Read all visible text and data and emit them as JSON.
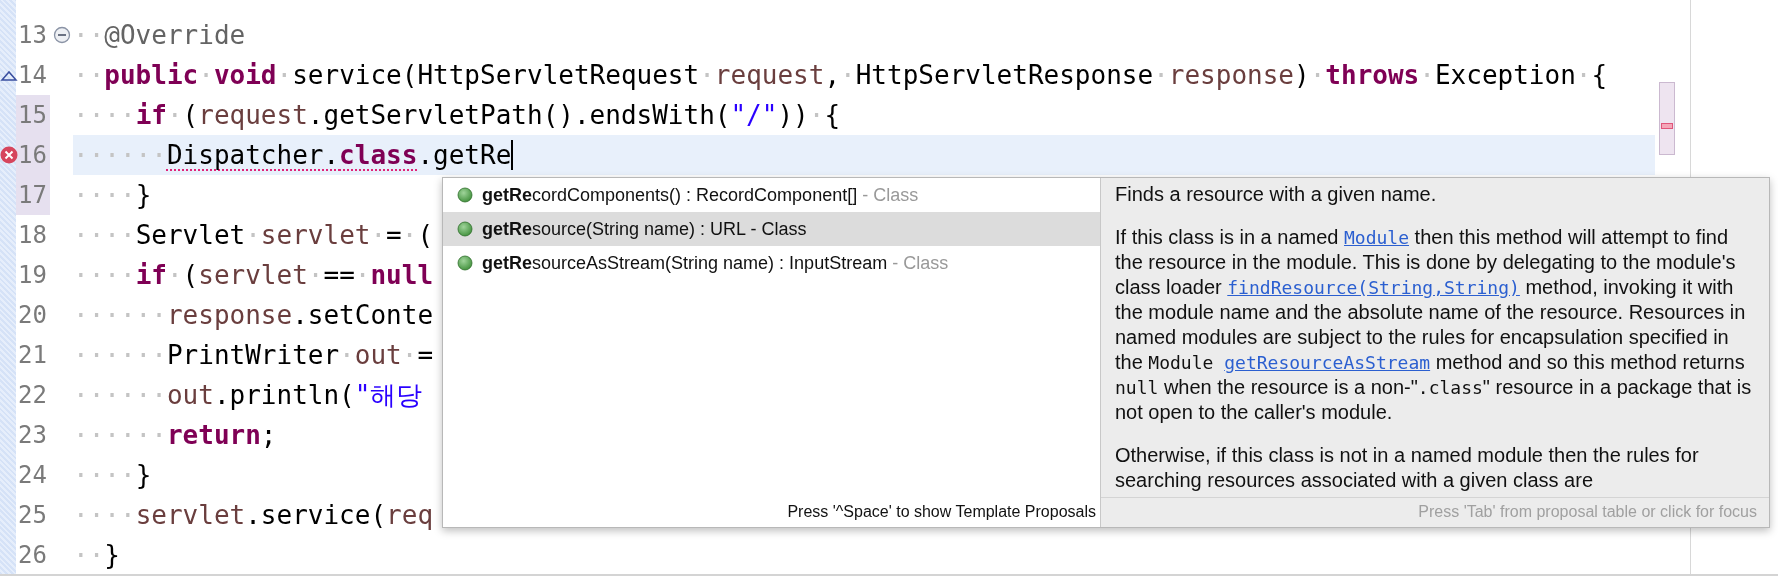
{
  "editor": {
    "lines": [
      {
        "number": "13",
        "kind": "fold",
        "changed": false,
        "current": false,
        "caret": false,
        "tokens": [
          {
            "kind": "ws",
            "text": "··"
          },
          {
            "kind": "ann",
            "text": "@Override"
          }
        ]
      },
      {
        "number": "14",
        "kind": "override",
        "changed": false,
        "current": false,
        "caret": false,
        "tokens": [
          {
            "kind": "ws",
            "text": "··"
          },
          {
            "kind": "kw",
            "text": "public"
          },
          {
            "kind": "ws",
            "text": "·"
          },
          {
            "kind": "kw",
            "text": "void"
          },
          {
            "kind": "ws",
            "text": "·"
          },
          {
            "kind": "txt",
            "text": "service(HttpServletRequest"
          },
          {
            "kind": "ws",
            "text": "·"
          },
          {
            "kind": "var",
            "text": "request"
          },
          {
            "kind": "txt",
            "text": ","
          },
          {
            "kind": "ws",
            "text": "·"
          },
          {
            "kind": "txt",
            "text": "HttpServletResponse"
          },
          {
            "kind": "ws",
            "text": "·"
          },
          {
            "kind": "var",
            "text": "response"
          },
          {
            "kind": "txt",
            "text": ")"
          },
          {
            "kind": "ws",
            "text": "·"
          },
          {
            "kind": "kw",
            "text": "throws"
          },
          {
            "kind": "ws",
            "text": "·"
          },
          {
            "kind": "txt",
            "text": "Exception"
          },
          {
            "kind": "ws",
            "text": "·"
          },
          {
            "kind": "txt",
            "text": "{"
          }
        ]
      },
      {
        "number": "15",
        "kind": "plain",
        "changed": true,
        "current": false,
        "caret": false,
        "tokens": [
          {
            "kind": "ws",
            "text": "····"
          },
          {
            "kind": "kw",
            "text": "if"
          },
          {
            "kind": "ws",
            "text": "·"
          },
          {
            "kind": "txt",
            "text": "("
          },
          {
            "kind": "var",
            "text": "request"
          },
          {
            "kind": "txt",
            "text": ".getServletPath().endsWith("
          },
          {
            "kind": "str",
            "text": "\"/\""
          },
          {
            "kind": "txt",
            "text": "))"
          },
          {
            "kind": "ws",
            "text": "·"
          },
          {
            "kind": "txt",
            "text": "{"
          }
        ]
      },
      {
        "number": "16",
        "kind": "error",
        "changed": true,
        "current": true,
        "caret": true,
        "tokens": [
          {
            "kind": "ws",
            "text": "······"
          },
          {
            "kind": "errtxt",
            "text": "Dispatcher."
          },
          {
            "kind": "errkw",
            "text": "class"
          },
          {
            "kind": "txt",
            "text": ".getRe"
          }
        ]
      },
      {
        "number": "17",
        "kind": "plain",
        "changed": true,
        "current": false,
        "caret": false,
        "tokens": [
          {
            "kind": "ws",
            "text": "····"
          },
          {
            "kind": "txt",
            "text": "}"
          }
        ]
      },
      {
        "number": "18",
        "kind": "plain",
        "changed": false,
        "current": false,
        "caret": false,
        "tokens": [
          {
            "kind": "ws",
            "text": "····"
          },
          {
            "kind": "txt",
            "text": "Servlet"
          },
          {
            "kind": "ws",
            "text": "·"
          },
          {
            "kind": "var",
            "text": "servlet"
          },
          {
            "kind": "ws",
            "text": "·"
          },
          {
            "kind": "txt",
            "text": "="
          },
          {
            "kind": "ws",
            "text": "·"
          },
          {
            "kind": "txt",
            "text": "("
          }
        ]
      },
      {
        "number": "19",
        "kind": "plain",
        "changed": false,
        "current": false,
        "caret": false,
        "tokens": [
          {
            "kind": "ws",
            "text": "····"
          },
          {
            "kind": "kw",
            "text": "if"
          },
          {
            "kind": "ws",
            "text": "·"
          },
          {
            "kind": "txt",
            "text": "("
          },
          {
            "kind": "var",
            "text": "servlet"
          },
          {
            "kind": "ws",
            "text": "·"
          },
          {
            "kind": "txt",
            "text": "=="
          },
          {
            "kind": "ws",
            "text": "·"
          },
          {
            "kind": "kw",
            "text": "null"
          }
        ]
      },
      {
        "number": "20",
        "kind": "plain",
        "changed": false,
        "current": false,
        "caret": false,
        "tokens": [
          {
            "kind": "ws",
            "text": "······"
          },
          {
            "kind": "var",
            "text": "response"
          },
          {
            "kind": "txt",
            "text": ".setConte"
          }
        ]
      },
      {
        "number": "21",
        "kind": "plain",
        "changed": false,
        "current": false,
        "caret": false,
        "tokens": [
          {
            "kind": "ws",
            "text": "······"
          },
          {
            "kind": "txt",
            "text": "PrintWriter"
          },
          {
            "kind": "ws",
            "text": "·"
          },
          {
            "kind": "var",
            "text": "out"
          },
          {
            "kind": "ws",
            "text": "·"
          },
          {
            "kind": "txt",
            "text": "="
          }
        ]
      },
      {
        "number": "22",
        "kind": "plain",
        "changed": false,
        "current": false,
        "caret": false,
        "tokens": [
          {
            "kind": "ws",
            "text": "······"
          },
          {
            "kind": "var",
            "text": "out"
          },
          {
            "kind": "txt",
            "text": ".println("
          },
          {
            "kind": "str",
            "text": "\"해당"
          }
        ]
      },
      {
        "number": "23",
        "kind": "plain",
        "changed": false,
        "current": false,
        "caret": false,
        "tokens": [
          {
            "kind": "ws",
            "text": "······"
          },
          {
            "kind": "kw",
            "text": "return"
          },
          {
            "kind": "txt",
            "text": ";"
          }
        ]
      },
      {
        "number": "24",
        "kind": "plain",
        "changed": false,
        "current": false,
        "caret": false,
        "tokens": [
          {
            "kind": "ws",
            "text": "····"
          },
          {
            "kind": "txt",
            "text": "}"
          }
        ]
      },
      {
        "number": "25",
        "kind": "plain",
        "changed": false,
        "current": false,
        "caret": false,
        "tokens": [
          {
            "kind": "ws",
            "text": "····"
          },
          {
            "kind": "var",
            "text": "servlet"
          },
          {
            "kind": "txt",
            "text": ".service("
          },
          {
            "kind": "var",
            "text": "req"
          }
        ]
      },
      {
        "number": "26",
        "kind": "plain",
        "changed": false,
        "current": false,
        "caret": false,
        "tokens": [
          {
            "kind": "ws",
            "text": "··"
          },
          {
            "kind": "txt",
            "text": "}"
          }
        ]
      }
    ]
  },
  "completion": {
    "proposals": [
      {
        "match": "getRe",
        "rest": "cordComponents() : RecordComponent[]",
        "qualifier": "- Class",
        "selected": false
      },
      {
        "match": "getRe",
        "rest": "source(String name) : URL",
        "qualifier": "- Class",
        "selected": true
      },
      {
        "match": "getRe",
        "rest": "sourceAsStream(String name) : InputStream",
        "qualifier": "- Class",
        "selected": false
      }
    ],
    "footer": "Press '^Space' to show Template Proposals",
    "doc": {
      "paragraphs": [
        [
          {
            "kind": "text",
            "text": "Finds a resource with a given name."
          }
        ],
        [
          {
            "kind": "text",
            "text": "If this class is in a named "
          },
          {
            "kind": "link",
            "text": "Module"
          },
          {
            "kind": "text",
            "text": " then this method will attempt to find the resource in the module. This is done by delegating to the module's class loader "
          },
          {
            "kind": "link",
            "text": "findResource(String,String)"
          },
          {
            "kind": "text",
            "text": " method, invoking it with the module name and the absolute name of the resource. Resources in named modules are subject to the rules for encapsulation specified in the "
          },
          {
            "kind": "code",
            "text": "Module "
          },
          {
            "kind": "link",
            "text": "getResourceAsStream"
          },
          {
            "kind": "text",
            "text": " method and so this method returns "
          },
          {
            "kind": "code",
            "text": "null"
          },
          {
            "kind": "text",
            "text": " when the resource is a non-\""
          },
          {
            "kind": "code",
            "text": ".class"
          },
          {
            "kind": "text",
            "text": "\" resource in a package that is not open to the caller's module."
          }
        ],
        [
          {
            "kind": "text",
            "text": "Otherwise, if this class is not in a named module then the rules for searching resources associated with a given class are"
          }
        ]
      ],
      "footer": "Press 'Tab' from proposal table or click for focus"
    }
  }
}
